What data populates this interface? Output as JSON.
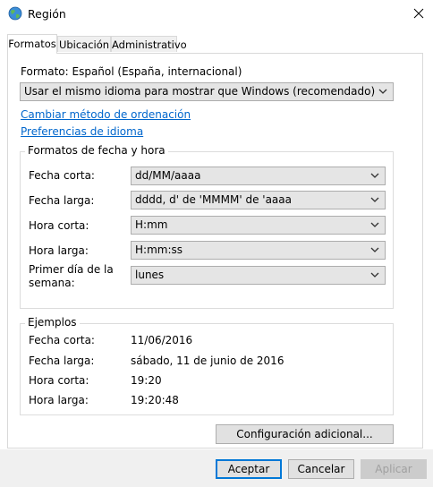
{
  "window": {
    "title": "Región",
    "close_glyph": "✕"
  },
  "tabs": [
    {
      "label": "Formatos",
      "active": true
    },
    {
      "label": "Ubicación",
      "active": false
    },
    {
      "label": "Administrativo",
      "active": false
    }
  ],
  "format": {
    "label": "Formato: Español (España, internacional)",
    "combo_value": "Usar el mismo idioma para mostrar que Windows (recomendado)"
  },
  "links": {
    "sort_method": "Cambiar método de ordenación",
    "language_prefs": "Preferencias de idioma"
  },
  "date_time_group": {
    "legend": "Formatos de fecha y hora",
    "rows": [
      {
        "label": "Fecha corta:",
        "value": "dd/MM/aaaa"
      },
      {
        "label": "Fecha larga:",
        "value": "dddd, d' de 'MMMM' de 'aaaa"
      },
      {
        "label": "Hora corta:",
        "value": "H:mm"
      },
      {
        "label": "Hora larga:",
        "value": "H:mm:ss"
      },
      {
        "label_line1": "Primer día de la",
        "label_line2": "semana:",
        "value": "lunes"
      }
    ]
  },
  "examples_group": {
    "legend": "Ejemplos",
    "rows": [
      {
        "label": "Fecha corta:",
        "value": "11/06/2016"
      },
      {
        "label": "Fecha larga:",
        "value": "sábado, 11 de junio de 2016"
      },
      {
        "label": "Hora corta:",
        "value": "19:20"
      },
      {
        "label": "Hora larga:",
        "value": "19:20:48"
      }
    ]
  },
  "buttons": {
    "additional_settings": "Configuración adicional...",
    "accept": "Aceptar",
    "cancel": "Cancelar",
    "apply": "Aplicar"
  },
  "colors": {
    "link": "#0066cc",
    "accent": "#0078d7"
  }
}
